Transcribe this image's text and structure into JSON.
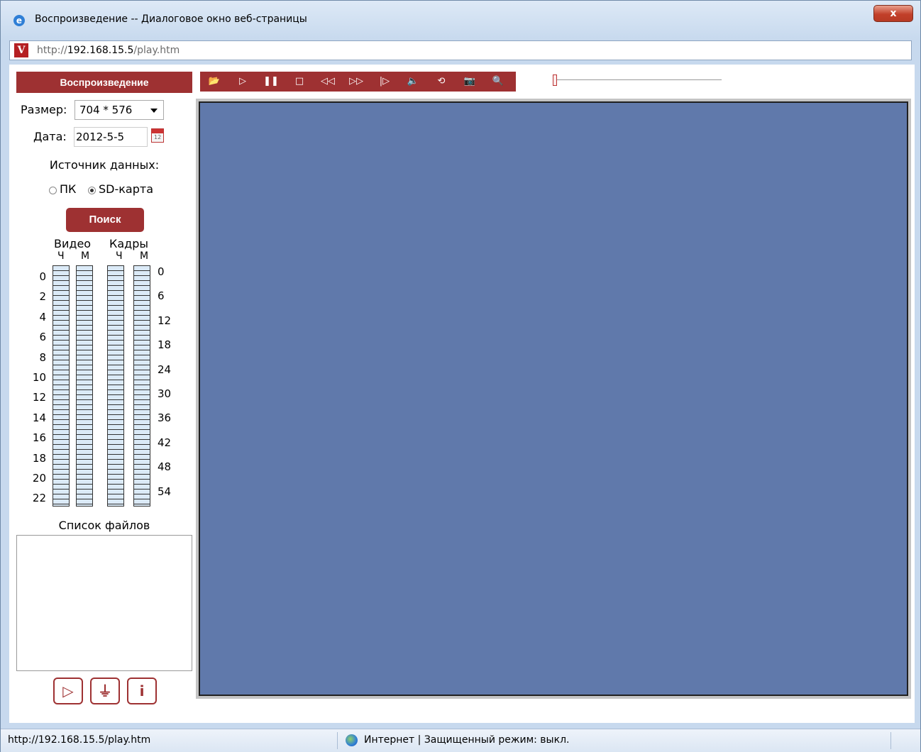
{
  "window": {
    "title": "Воспроизведение -- Диалоговое окно веб-страницы",
    "close_label": "x",
    "address_host": "192.168.15.5",
    "address_prefix": "http://",
    "address_path": "/play.htm"
  },
  "sidebar": {
    "header": "Воспроизведение",
    "size_label": "Размер:",
    "size_value": "704 * 576",
    "date_label": "Дата:",
    "date_value": "2012-5-5",
    "calendar_text": "12",
    "source_label": "Источник данных:",
    "source_options": [
      {
        "label": "ПК",
        "checked": false
      },
      {
        "label": "SD-карта",
        "checked": true
      }
    ],
    "search_button": "Поиск",
    "grid": {
      "video_header": "Видео",
      "frames_header": "Кадры",
      "hours_sub": "Ч",
      "minutes_sub": "М",
      "hour_labels": [
        "0",
        "2",
        "4",
        "6",
        "8",
        "10",
        "12",
        "14",
        "16",
        "18",
        "20",
        "22"
      ],
      "minute_labels": [
        "0",
        "6",
        "12",
        "18",
        "24",
        "30",
        "36",
        "42",
        "48",
        "54"
      ]
    },
    "files_label": "Список файлов",
    "bottom_buttons": [
      {
        "name": "play-file",
        "glyph": "▷"
      },
      {
        "name": "download-file",
        "glyph": "⏚"
      },
      {
        "name": "file-info",
        "glyph": "i"
      }
    ]
  },
  "toolbar": {
    "buttons": [
      {
        "name": "open-folder",
        "glyph": "📂"
      },
      {
        "name": "play",
        "glyph": "▷"
      },
      {
        "name": "pause",
        "glyph": "❚❚"
      },
      {
        "name": "stop",
        "glyph": "□"
      },
      {
        "name": "rewind",
        "glyph": "◁◁"
      },
      {
        "name": "fast-forward",
        "glyph": "▷▷"
      },
      {
        "name": "step",
        "glyph": "|▷"
      },
      {
        "name": "volume",
        "glyph": "🔈"
      },
      {
        "name": "loop",
        "glyph": "⟲"
      },
      {
        "name": "snapshot",
        "glyph": "📷"
      },
      {
        "name": "zoom",
        "glyph": "🔍"
      }
    ]
  },
  "statusbar": {
    "url": "http://192.168.15.5/play.htm",
    "zone": "Интернет | Защищенный режим: выкл."
  }
}
